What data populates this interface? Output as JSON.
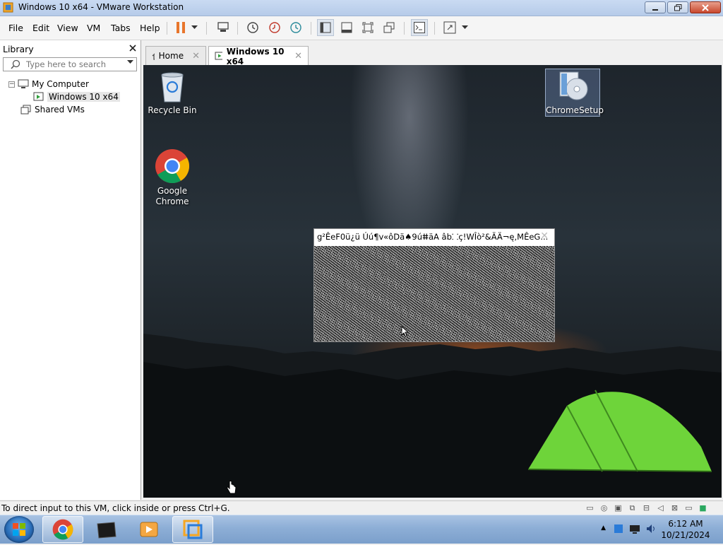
{
  "window": {
    "title": "Windows 10 x64 - VMware Workstation",
    "controls": [
      "minimize",
      "restore",
      "close"
    ]
  },
  "menu": {
    "items": [
      {
        "label": "File",
        "mnemonic": "F"
      },
      {
        "label": "Edit",
        "mnemonic": "E"
      },
      {
        "label": "View",
        "mnemonic": "V"
      },
      {
        "label": "VM",
        "mnemonic": "M"
      },
      {
        "label": "Tabs",
        "mnemonic": "T"
      },
      {
        "label": "Help",
        "mnemonic": "H"
      }
    ]
  },
  "toolbar": {
    "buttons": [
      "pause-icon",
      "send-ctrl-alt-del-icon",
      "snapshot-icon",
      "revert-snapshot-icon",
      "snapshot-manager-icon",
      "show-library-icon",
      "thumbnail-bar-icon",
      "full-screen-icon",
      "unity-icon",
      "console-view-icon",
      "stretch-guest-icon"
    ]
  },
  "library": {
    "title": "Library",
    "search_placeholder": "Type here to search",
    "tree": {
      "root": "My Computer",
      "children": [
        "Windows 10 x64"
      ],
      "shared": "Shared VMs"
    }
  },
  "tabs": [
    {
      "label": "Home",
      "active": false
    },
    {
      "label": "Windows 10 x64",
      "active": true
    }
  ],
  "vm_desktop": {
    "icons": [
      {
        "label": "Recycle Bin"
      },
      {
        "label": "Google\nChrome",
        "line1": "Google",
        "line2": "Chrome"
      },
      {
        "label": "ChromeSetup",
        "selected": true
      }
    ],
    "popup": {
      "title": "g²ÊeF0ü¿ü Úú¶v«ôDä♠9úⵌäA  âb⸬ç!WÎò²&ÄÄ¬ę,MÊeG..."
    }
  },
  "statusbar": {
    "message": "To direct input to this VM, click inside or press Ctrl+G."
  },
  "taskbar": {
    "clock_time": "6:12 AM",
    "clock_date": "10/21/2024"
  },
  "colors": {
    "title_bar": "#c9daf2",
    "close_button": "#c9472d",
    "taskbar": "#8daed6",
    "tent_green": "#6ed43a",
    "pause_orange": "#e8762c"
  }
}
